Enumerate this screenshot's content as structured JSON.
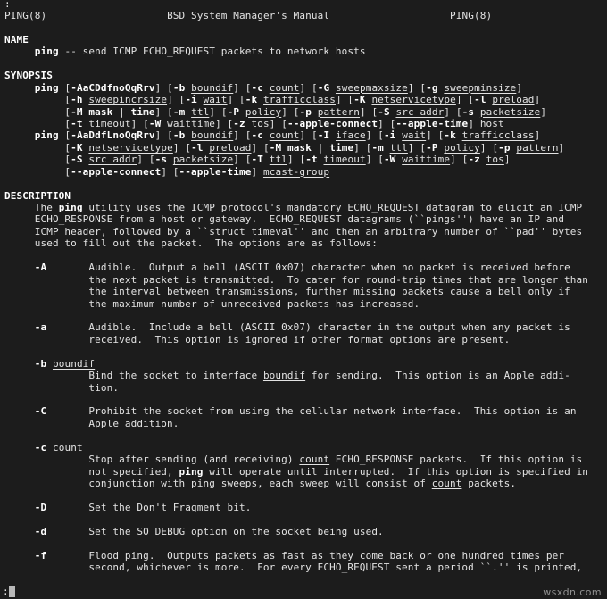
{
  "terminal": {
    "background_color": "#1c1c1c",
    "foreground_color": "#e3e3e3",
    "bold_color": "#ffffff",
    "cursor_color": "#b9b9b9",
    "top_partial_prompt": ":",
    "pager_prompt": ":",
    "watermark": "wsxdn.com"
  },
  "manpage": {
    "header": {
      "left": "PING(8)",
      "center": "BSD System Manager's Manual",
      "right": "PING(8)"
    },
    "sections": {
      "name": {
        "heading": "NAME",
        "body_prefix": "     ",
        "command": "ping",
        "body": " -- send ICMP ECHO_REQUEST packets to network hosts"
      },
      "synopsis": {
        "heading": "SYNOPSIS",
        "block1": {
          "command": "ping",
          "lines": [
            " [-AaCDdfnoQqRrv] [-b boundif] [-c count] [-G sweepmaxsize] [-g sweepminsize]",
            "[-h sweepincrsize] [-i wait] [-k trafficclass] [-K netservicetype] [-l preload]",
            "[-M mask | time] [-m ttl] [-P policy] [-p pattern] [-S src_addr] [-s packetsize]",
            "[-t timeout] [-W waittime] [-z tos] [--apple-connect] [--apple-time] host"
          ]
        },
        "block2": {
          "command": "ping",
          "lines": [
            " [-AaDdfLnoQqRrv] [-b boundif] [-c count] [-I iface] [-i wait] [-k trafficclass]",
            "[-K netservicetype] [-l preload] [-M mask | time] [-m ttl] [-P policy] [-p pattern]",
            "[-S src_addr] [-s packetsize] [-T ttl] [-t timeout] [-W waittime] [-z tos]",
            "[--apple-connect] [--apple-time] mcast-group"
          ]
        }
      },
      "description": {
        "heading": "DESCRIPTION",
        "paragraph": [
          "The ping utility uses the ICMP protocol's mandatory ECHO_REQUEST datagram to elicit an ICMP",
          "ECHO_RESPONSE from a host or gateway.  ECHO_REQUEST datagrams (``pings'') have an IP and",
          "ICMP header, followed by a ``struct timeval'' and then an arbitrary number of ``pad'' bytes",
          "used to fill out the packet.  The options are as follows:"
        ],
        "options": [
          {
            "flag": "-A",
            "arg": "",
            "inline": true,
            "text": [
              "Audible.  Output a bell (ASCII 0x07) character when no packet is received before",
              "the next packet is transmitted.  To cater for round-trip times that are longer than",
              "the interval between transmissions, further missing packets cause a bell only if",
              "the maximum number of unreceived packets has increased."
            ]
          },
          {
            "flag": "-a",
            "arg": "",
            "inline": true,
            "text": [
              "Audible.  Include a bell (ASCII 0x07) character in the output when any packet is",
              "received.  This option is ignored if other format options are present."
            ]
          },
          {
            "flag": "-b",
            "arg": "boundif",
            "inline": false,
            "text": [
              "Bind the socket to interface boundif for sending.  This option is an Apple addi-",
              "tion."
            ]
          },
          {
            "flag": "-C",
            "arg": "",
            "inline": true,
            "text": [
              "Prohibit the socket from using the cellular network interface.  This option is an",
              "Apple addition."
            ]
          },
          {
            "flag": "-c",
            "arg": "count",
            "inline": false,
            "text": [
              "Stop after sending (and receiving) count ECHO_RESPONSE packets.  If this option is",
              "not specified, ping will operate until interrupted.  If this option is specified in",
              "conjunction with ping sweeps, each sweep will consist of count packets."
            ]
          },
          {
            "flag": "-D",
            "arg": "",
            "inline": true,
            "text": [
              "Set the Don't Fragment bit."
            ]
          },
          {
            "flag": "-d",
            "arg": "",
            "inline": true,
            "text": [
              "Set the SO_DEBUG option on the socket being used."
            ]
          },
          {
            "flag": "-f",
            "arg": "",
            "inline": true,
            "text": [
              "Flood ping.  Outputs packets as fast as they come back or one hundred times per",
              "second, whichever is more.  For every ECHO_REQUEST sent a period ``.'' is printed,"
            ]
          }
        ]
      }
    }
  }
}
